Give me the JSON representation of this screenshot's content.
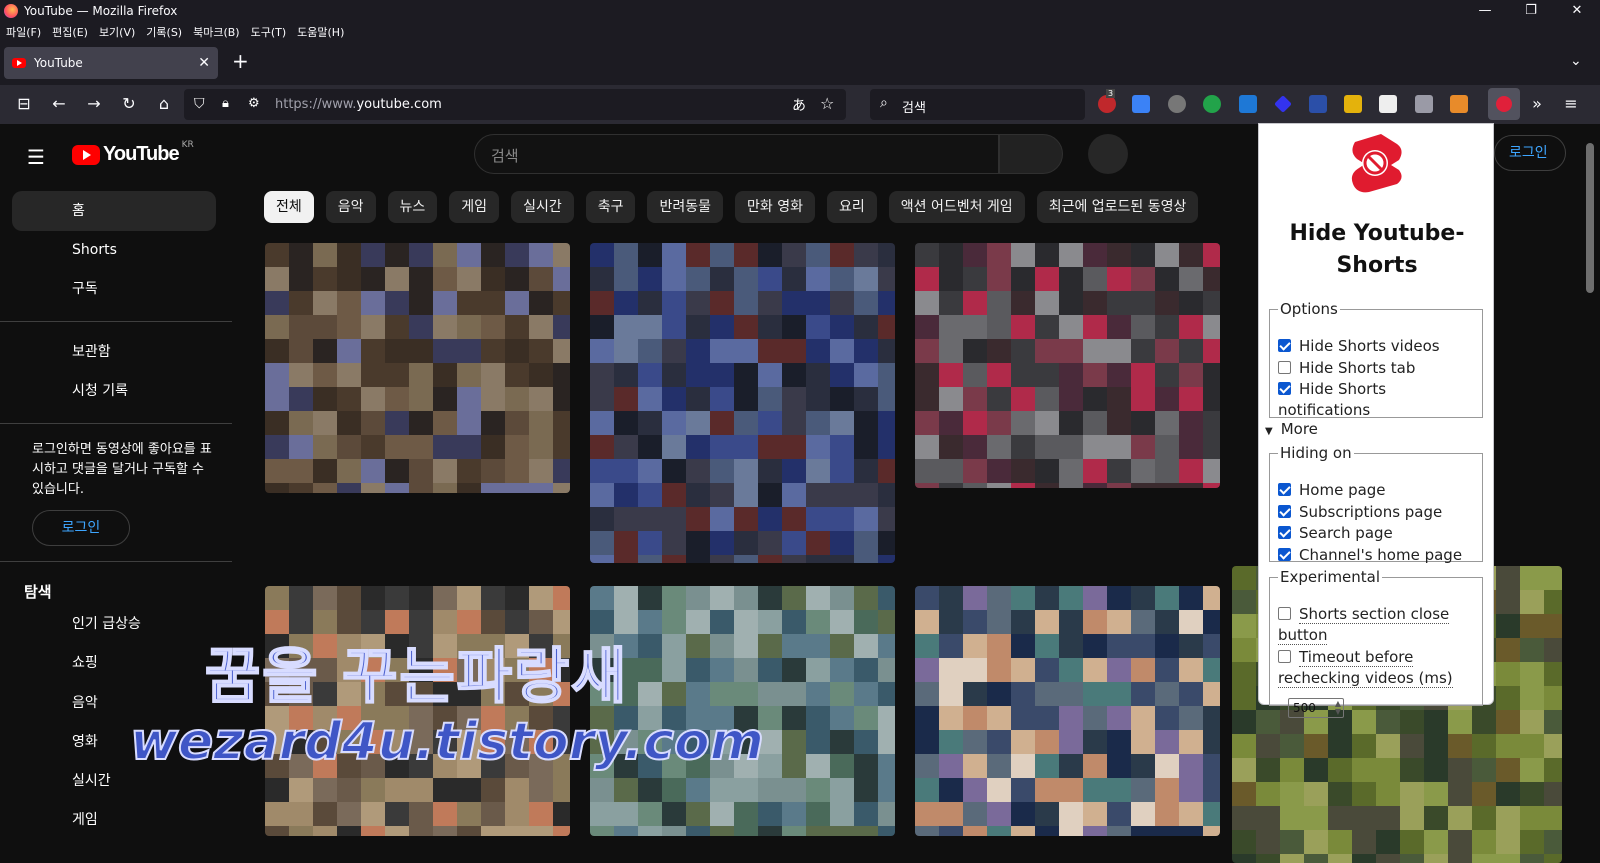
{
  "window": {
    "title": "YouTube — Mozilla Firefox",
    "controls": [
      "—",
      "❐",
      "✕"
    ]
  },
  "menubar": [
    "파일(F)",
    "편집(E)",
    "보기(V)",
    "기록(S)",
    "북마크(B)",
    "도구(T)",
    "도움말(H)"
  ],
  "tabs": [
    {
      "label": "YouTube",
      "close": "✕"
    }
  ],
  "toolbar": {
    "new_tab": "+",
    "tab_list": "⌄",
    "url_prefix": "https://www.",
    "url_host": "youtube.com",
    "search_placeholder": "검색",
    "ext_badge": "3"
  },
  "youtube": {
    "logo_text": "YouTube",
    "logo_region": "KR",
    "search_placeholder": "검색",
    "signin_top": "로그인",
    "sidebar": {
      "items_main": [
        "홈",
        "Shorts",
        "구독"
      ],
      "items_library": [
        "보관함",
        "시청 기록"
      ],
      "signin_note": "로그인하면 동영상에 좋아요를 표시하고 댓글을 달거나 구독할 수 있습니다.",
      "signin_button": "로그인",
      "explore_heading": "탐색",
      "explore_items": [
        "인기 급상승",
        "쇼핑",
        "음악",
        "영화",
        "실시간",
        "게임"
      ]
    },
    "chips": [
      "전체",
      "음악",
      "뉴스",
      "게임",
      "실시간",
      "축구",
      "반려동물",
      "만화 영화",
      "요리",
      "액션 어드벤처 게임",
      "최근에 업로드된 동영상"
    ]
  },
  "watermark": {
    "line1": "꿈을 꾸는파랑새",
    "line2": "wezard4u.tistory.com"
  },
  "popup": {
    "title": "Hide Youtube-Shorts",
    "options_legend": "Options",
    "options": [
      {
        "label": "Hide Shorts videos",
        "checked": true
      },
      {
        "label": "Hide Shorts tab",
        "checked": false
      },
      {
        "label": "Hide Shorts notifications",
        "checked": true
      }
    ],
    "more_label": "More",
    "hiding_legend": "Hiding on",
    "hiding": [
      {
        "label": "Home page",
        "checked": true
      },
      {
        "label": "Subscriptions page",
        "checked": true
      },
      {
        "label": "Search page",
        "checked": true
      },
      {
        "label": "Channel's home page",
        "checked": true
      }
    ],
    "experimental_legend": "Experimental",
    "experimental": [
      {
        "label": "Shorts section close button",
        "checked": false
      },
      {
        "label": "Timeout before rechecking videos (ms)",
        "checked": false
      }
    ],
    "timeout_value": "500"
  },
  "colors": {
    "yt_red": "#ff0000",
    "link_blue": "#3ea6ff",
    "checkbox_blue": "#0b57d0",
    "firefox_chrome": "#1c1b22"
  },
  "icons": [
    "firefox-logo-icon",
    "back-icon",
    "forward-icon",
    "reload-icon",
    "home-icon",
    "shield-icon",
    "lock-icon",
    "translate-icon",
    "bookmark-star-icon",
    "search-icon",
    "overflow-icon",
    "hamburger-icon"
  ]
}
